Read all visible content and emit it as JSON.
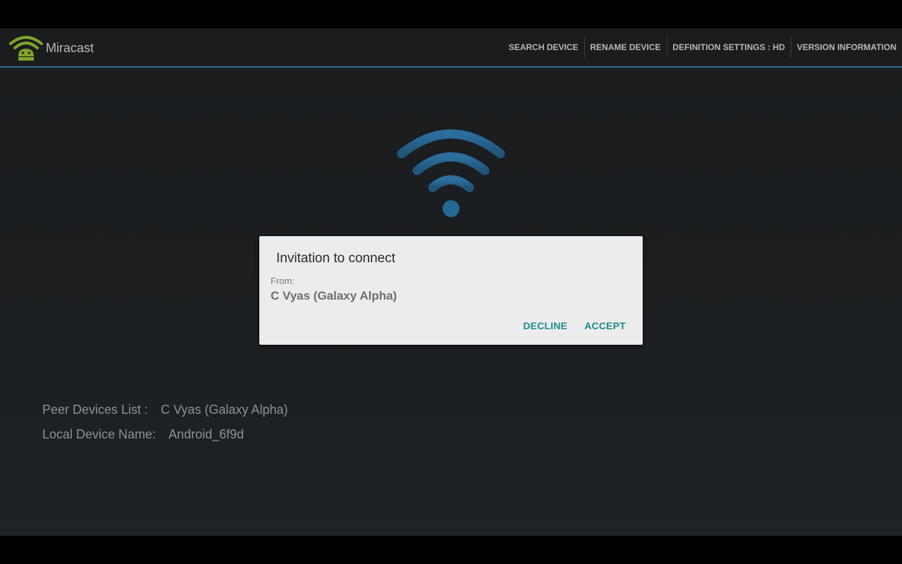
{
  "app": {
    "title": "Miracast",
    "logo_icon": "android-wifi-logo-icon"
  },
  "menu": {
    "items": [
      {
        "label": "SEARCH DEVICE"
      },
      {
        "label": "RENAME DEVICE"
      },
      {
        "label": "DEFINITION SETTINGS : HD"
      },
      {
        "label": "VERSION INFORMATION"
      }
    ]
  },
  "center_icon": "wifi-signal-icon",
  "dialog": {
    "title": "Invitation to connect",
    "from_label": "From:",
    "from_value": "C Vyas (Galaxy Alpha)",
    "decline_label": "DECLINE",
    "accept_label": "ACCEPT"
  },
  "info": {
    "peer_label": "Peer Devices List :",
    "peer_value": "C Vyas (Galaxy Alpha)",
    "local_label": "Local Device Name:",
    "local_value": "Android_6f9d"
  },
  "colors": {
    "accent_line": "#2f6e8c",
    "logo_green": "#7fa52a",
    "wifi_blue": "#2a6b9a",
    "button_teal": "#1e8a8c"
  }
}
